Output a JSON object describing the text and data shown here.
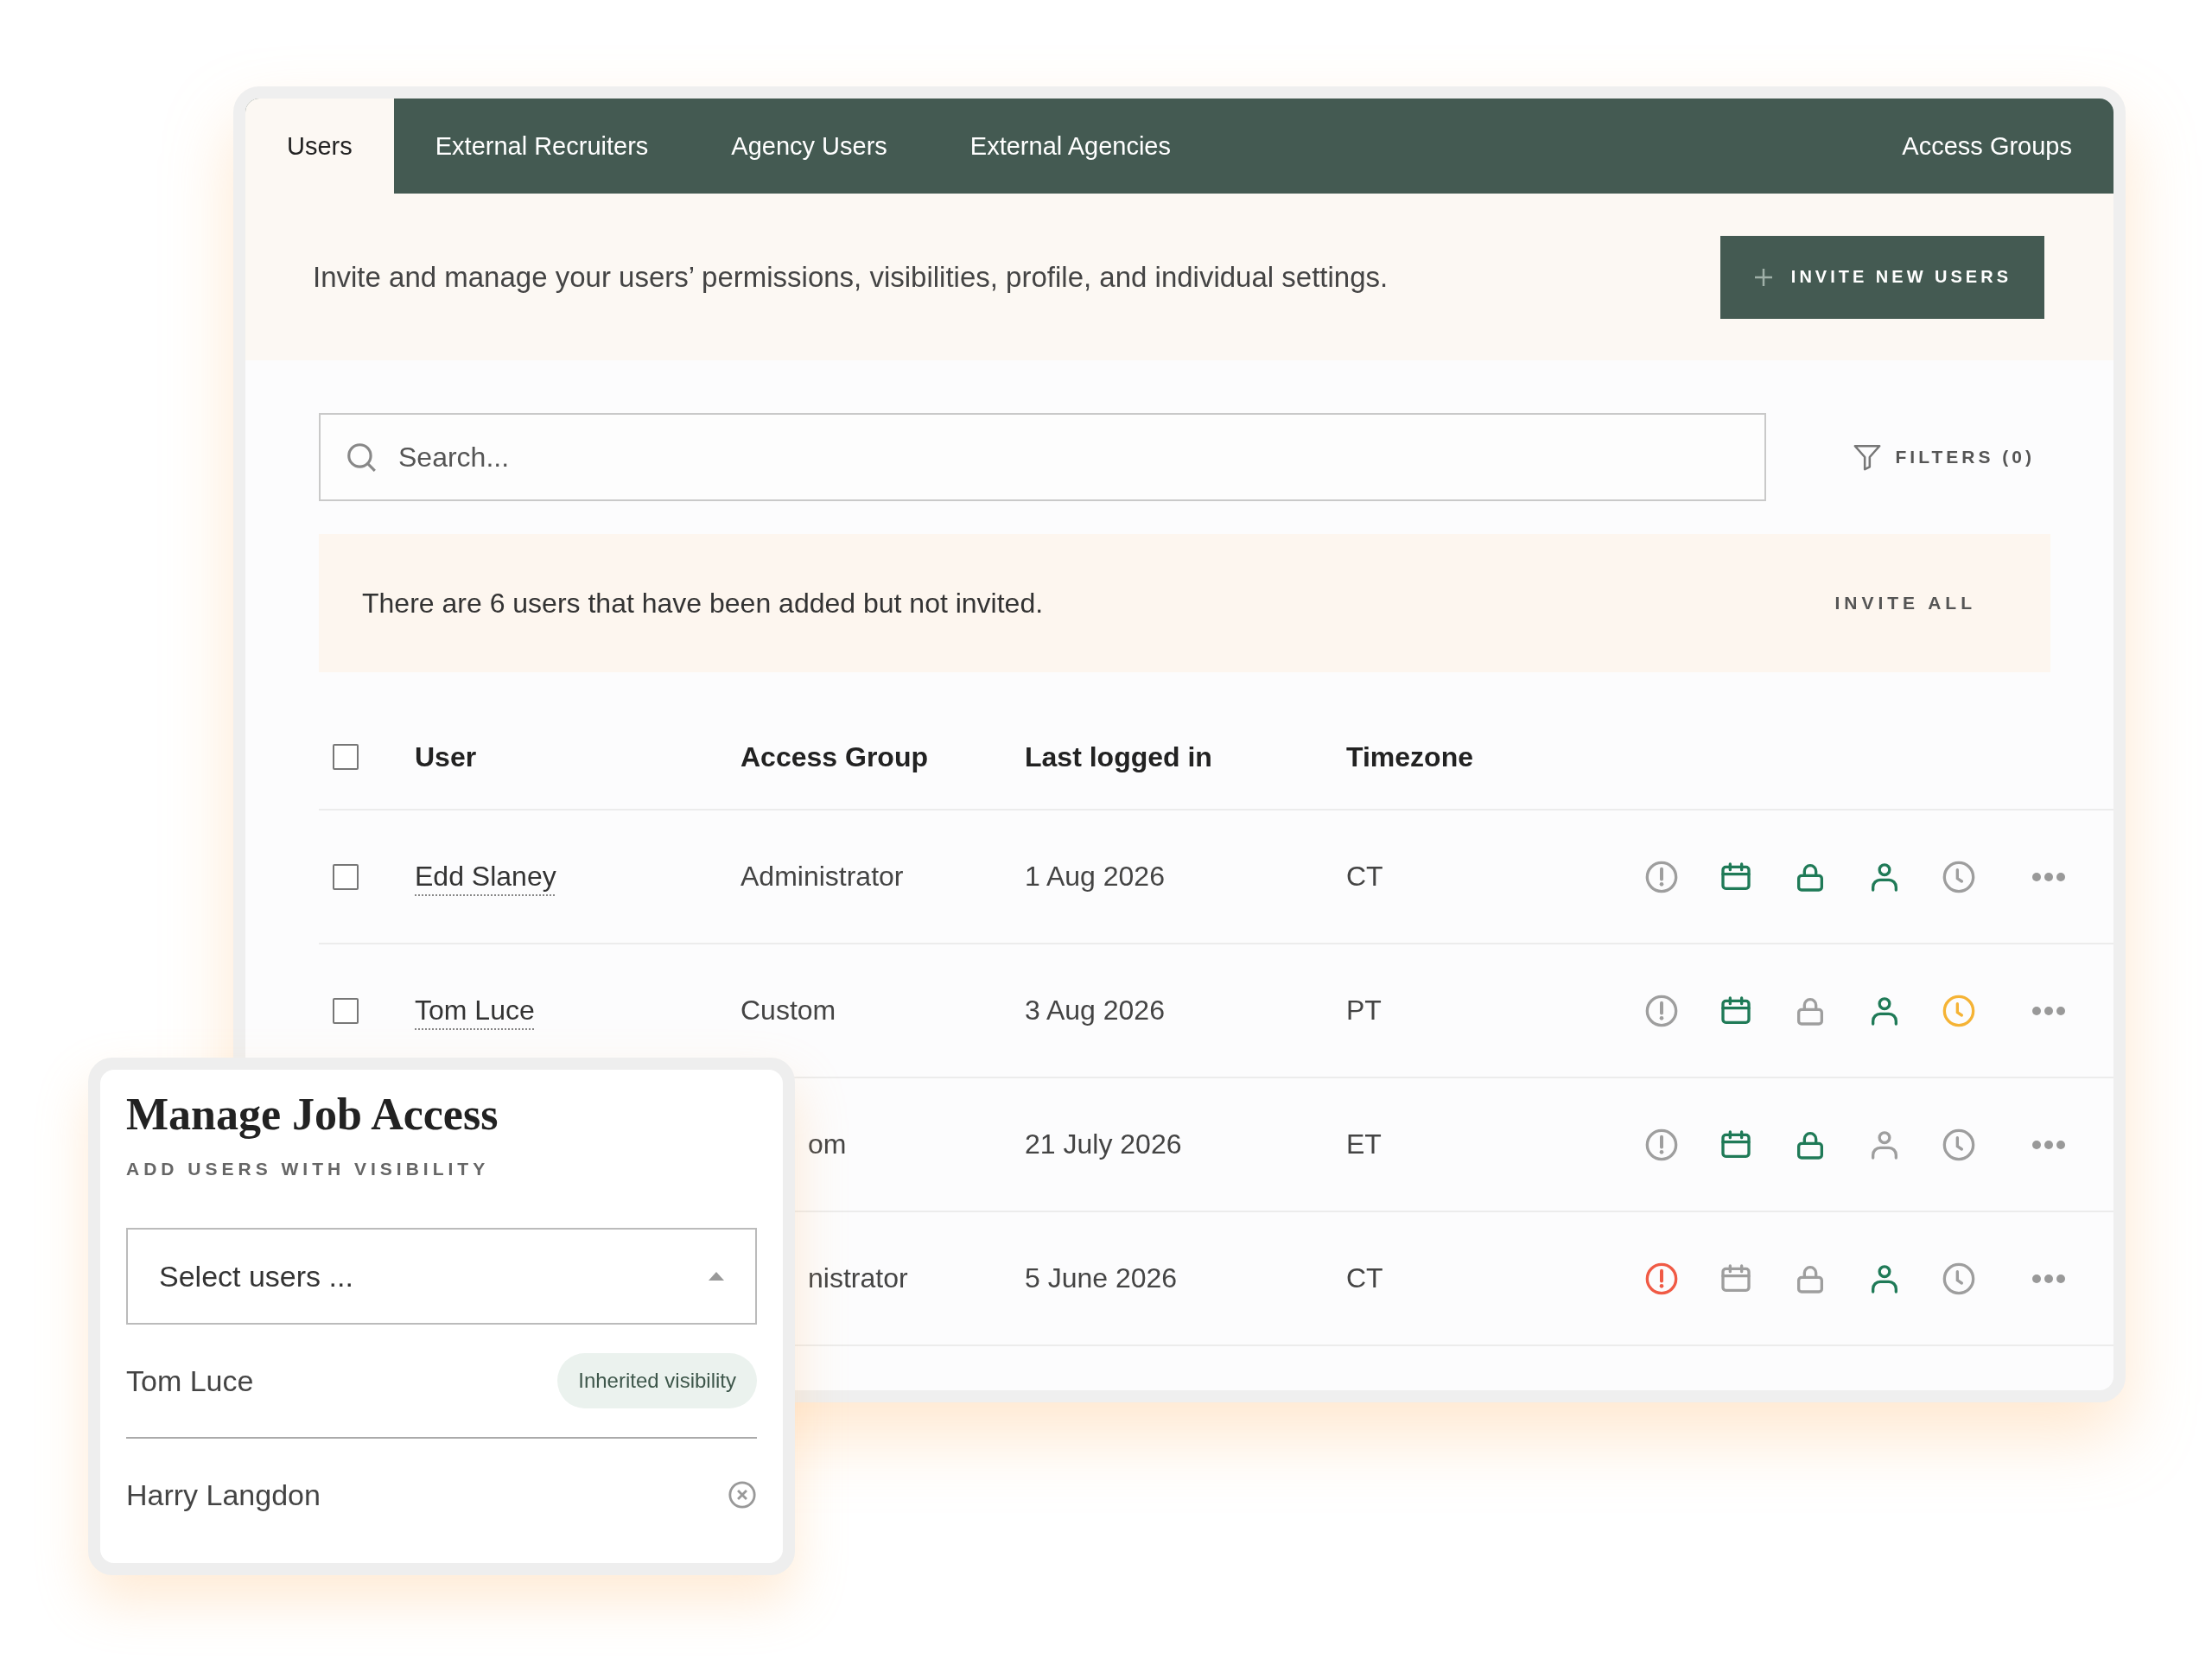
{
  "tabs": [
    {
      "label": "Users",
      "selected": true
    },
    {
      "label": "External Recruiters",
      "selected": false
    },
    {
      "label": "Agency Users",
      "selected": false
    },
    {
      "label": "External Agencies",
      "selected": false
    },
    {
      "label": "Access Groups",
      "selected": false
    }
  ],
  "intro": {
    "text": "Invite and manage your users’ permissions, visibilities, profile, and individual settings.",
    "button": "INVITE NEW USERS"
  },
  "search": {
    "placeholder": "Search..."
  },
  "filters": "FILTERS (0)",
  "notice": {
    "text": "There are 6 users that have been added but not invited.",
    "action": "INVITE ALL"
  },
  "table": {
    "select_all_checked": false,
    "columns": [
      "User",
      "Access Group",
      "Last logged in",
      "Timezone"
    ],
    "rows": [
      {
        "checked": false,
        "user": "Edd Slaney",
        "access_group": "Administrator",
        "last_logged_in": "1 Aug 2026",
        "timezone": "CT",
        "icons": [
          {
            "kind": "alert",
            "color": "#9e9e9e"
          },
          {
            "kind": "calendar",
            "color": "#1f7a57"
          },
          {
            "kind": "lock",
            "color": "#1f7a57"
          },
          {
            "kind": "person",
            "color": "#1f7a57"
          },
          {
            "kind": "clock",
            "color": "#9e9e9e"
          }
        ]
      },
      {
        "checked": false,
        "user": "Tom Luce",
        "access_group": "Custom",
        "last_logged_in": "3 Aug 2026",
        "timezone": "PT",
        "icons": [
          {
            "kind": "alert",
            "color": "#9e9e9e"
          },
          {
            "kind": "calendar",
            "color": "#1f7a57"
          },
          {
            "kind": "lock",
            "color": "#9e9e9e"
          },
          {
            "kind": "person",
            "color": "#1f7a57"
          },
          {
            "kind": "clock",
            "color": "#f5b335"
          }
        ]
      },
      {
        "access_group": "om",
        "last_logged_in": "21 July 2026",
        "timezone": "ET",
        "icons": [
          {
            "kind": "alert",
            "color": "#9e9e9e"
          },
          {
            "kind": "calendar",
            "color": "#1f7a57"
          },
          {
            "kind": "lock",
            "color": "#1f7a57"
          },
          {
            "kind": "person",
            "color": "#9e9e9e"
          },
          {
            "kind": "clock",
            "color": "#9e9e9e"
          }
        ]
      },
      {
        "access_group": "nistrator",
        "last_logged_in": "5 June 2026",
        "timezone": "CT",
        "icons": [
          {
            "kind": "alert",
            "color": "#f05a45"
          },
          {
            "kind": "calendar",
            "color": "#9e9e9e"
          },
          {
            "kind": "lock",
            "color": "#9e9e9e"
          },
          {
            "kind": "person",
            "color": "#1f7a57"
          },
          {
            "kind": "clock",
            "color": "#9e9e9e"
          }
        ]
      }
    ]
  },
  "popup": {
    "title": "Manage Job Access",
    "subtitle": "ADD USERS WITH VISIBILITY",
    "select": {
      "placeholder": "Select users ..."
    },
    "users": [
      {
        "name": "Tom Luce",
        "kind": "badge",
        "badge": "Inherited visibility"
      },
      {
        "name": "Harry Langdon",
        "kind": "removable"
      }
    ]
  }
}
